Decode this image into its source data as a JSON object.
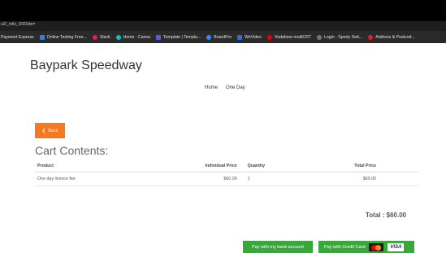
{
  "browser": {
    "url": "u2/_rolls_UID2dw=",
    "bookmarks": [
      {
        "label": "Payment Express",
        "color": ""
      },
      {
        "label": "Online Testing Free...",
        "color": "#3b7be0"
      },
      {
        "label": "Slack",
        "color": "#e01e5a"
      },
      {
        "label": "Home - Canva",
        "color": "#00c4cc"
      },
      {
        "label": "Template | Templa...",
        "color": "#5b5bd6"
      },
      {
        "label": "BoardPro",
        "color": "#2c8ff7"
      },
      {
        "label": "WeVideo",
        "color": "#2b6fd6"
      },
      {
        "label": "Vodafone multiCRT",
        "color": "#e60000"
      },
      {
        "label": "Login - Sporty Sett...",
        "color": "#777777"
      },
      {
        "label": "Address & Postcod...",
        "color": "#d22"
      }
    ]
  },
  "site": {
    "title": "Baypark Speedway"
  },
  "nav": {
    "items": [
      "Home",
      "One Day"
    ]
  },
  "back_button": "Back",
  "cart": {
    "title": "Cart Contents:",
    "headers": [
      "Product",
      "Individual Price",
      "Quantity",
      "Total Price"
    ],
    "rows": [
      [
        "One day licence fee",
        "$60.00",
        "1",
        "$60.00"
      ]
    ],
    "total": "Total : $60.00"
  },
  "payment": {
    "bank_label": "Pay with my bank account",
    "card_label": "Pay with Credit Card",
    "card_brand": "VISA"
  }
}
